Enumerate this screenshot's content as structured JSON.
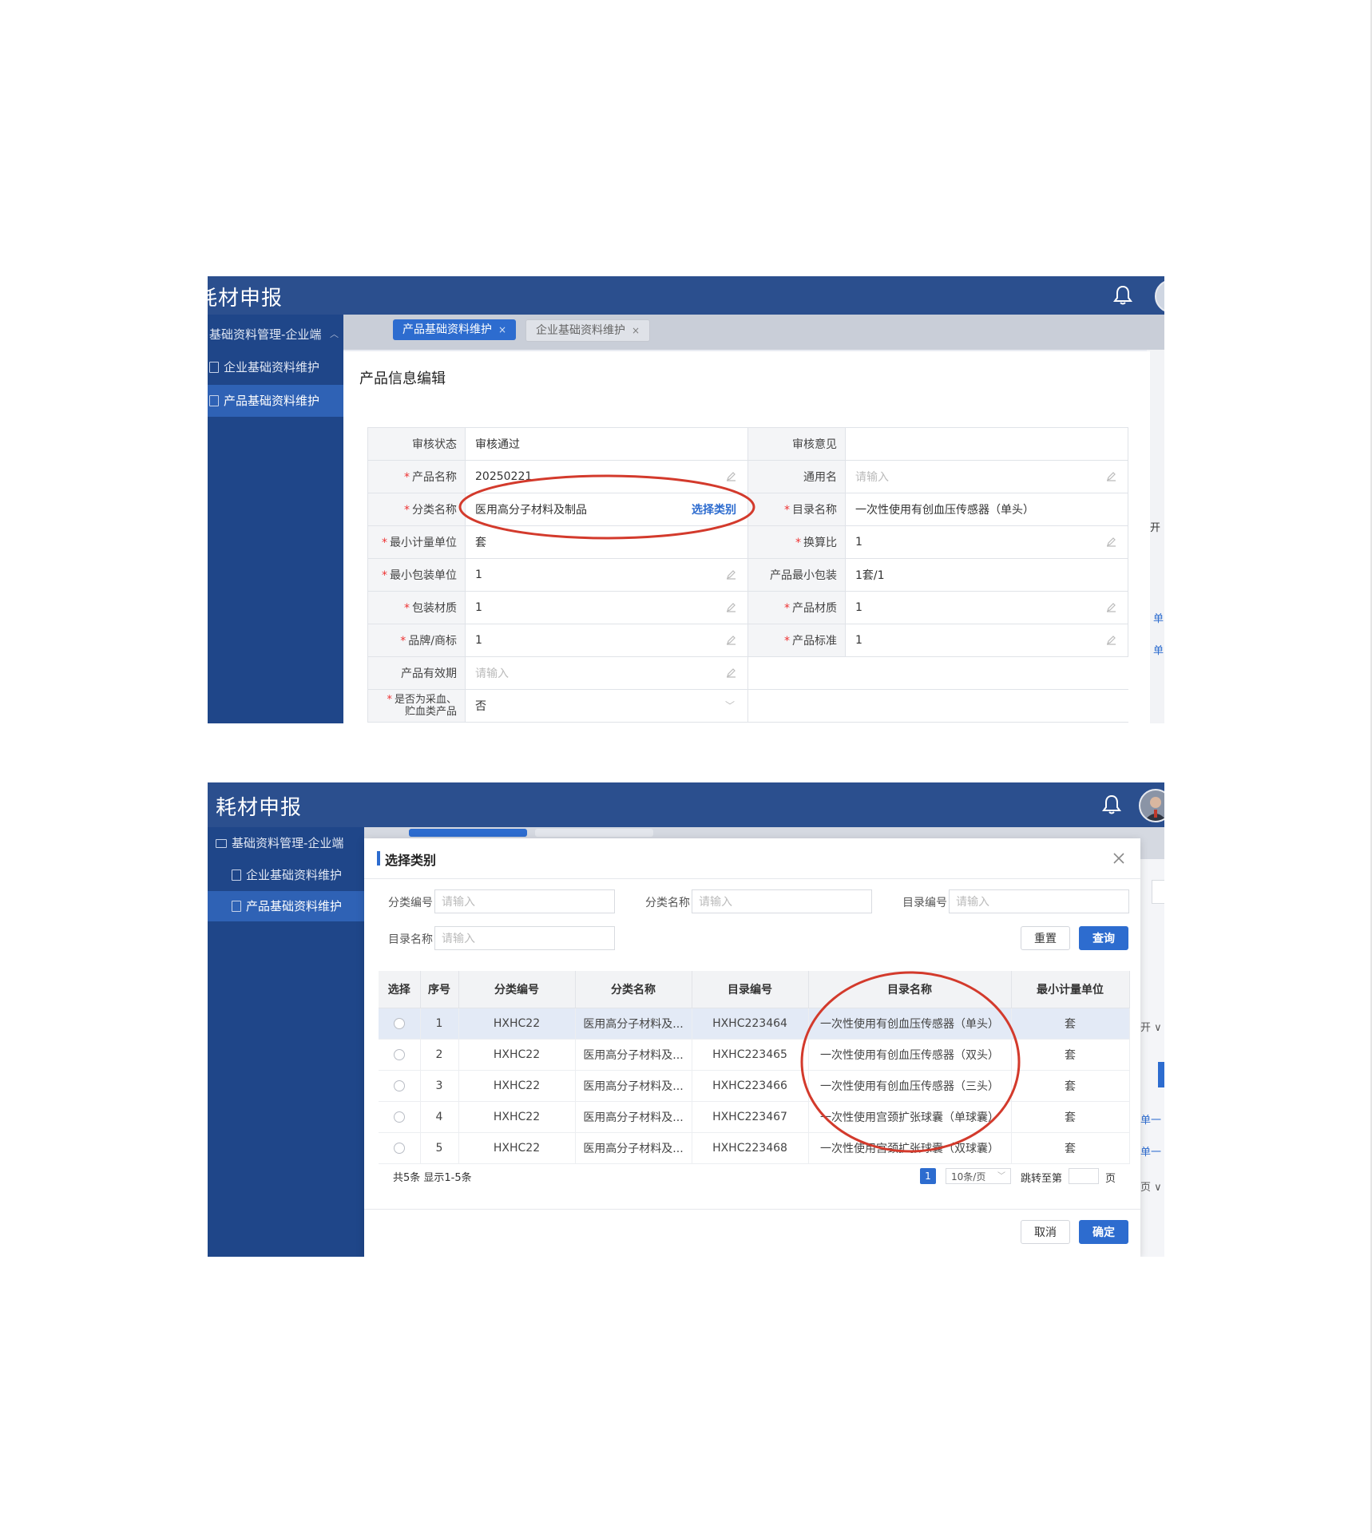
{
  "screen1": {
    "app_title": "耗材申报",
    "sidebar": {
      "group": "基础资料管理-企业端",
      "items": [
        {
          "label": "企业基础资料维护"
        },
        {
          "label": "产品基础资料维护"
        }
      ]
    },
    "tabs": [
      {
        "label": "产品基础资料维护",
        "close": "×"
      },
      {
        "label": "企业基础资料维护",
        "close": "×"
      }
    ],
    "panel_title": "产品信息编辑",
    "form": {
      "audit_status_label": "审核状态",
      "audit_status_value": "审核通过",
      "audit_opinion_label": "审核意见",
      "audit_opinion_value": "",
      "product_name_label": "产品名称",
      "product_name_value": "20250221",
      "common_name_label": "通用名",
      "common_name_placeholder": "请输入",
      "category_label": "分类名称",
      "category_value": "医用高分子材料及制品",
      "category_action": "选择类别",
      "catalog_name_label": "目录名称",
      "catalog_name_value": "一次性使用有创血压传感器（单头）",
      "min_unit_label": "最小计量单位",
      "min_unit_value": "套",
      "ratio_label": "换算比",
      "ratio_value": "1",
      "min_pack_unit_label": "最小包装单位",
      "min_pack_unit_value": "1",
      "product_min_pack_label": "产品最小包装",
      "product_min_pack_value": "1套/1",
      "pack_material_label": "包装材质",
      "pack_material_value": "1",
      "product_material_label": "产品材质",
      "product_material_value": "1",
      "brand_label": "品牌/商标",
      "brand_value": "1",
      "product_standard_label": "产品标准",
      "product_standard_value": "1",
      "validity_label": "产品有效期",
      "validity_placeholder": "请输入",
      "blood_label_1": "是否为采血、",
      "blood_label_2": "贮血类产品",
      "blood_value": "否"
    },
    "bg_fragments": [
      "开",
      "单",
      "单"
    ]
  },
  "screen2": {
    "app_title": "耗材申报",
    "sidebar": {
      "group": "基础资料管理-企业端",
      "items": [
        {
          "label": "企业基础资料维护"
        },
        {
          "label": "产品基础资料维护"
        }
      ]
    },
    "modal": {
      "title": "选择类别",
      "filters": {
        "category_code_label": "分类编号",
        "category_code_placeholder": "请输入",
        "category_name_label": "分类名称",
        "category_name_placeholder": "请输入",
        "catalog_code_label": "目录编号",
        "catalog_code_placeholder": "请输入",
        "catalog_name_label": "目录名称",
        "catalog_name_placeholder": "请输入"
      },
      "reset_label": "重置",
      "query_label": "查询",
      "columns": [
        "选择",
        "序号",
        "分类编号",
        "分类名称",
        "目录编号",
        "目录名称",
        "最小计量单位"
      ],
      "rows": [
        {
          "no": "1",
          "category_code": "HXHC22",
          "category_name": "医用高分子材料及...",
          "catalog_code": "HXHC223464",
          "catalog_name": "一次性使用有创血压传感器（单头）",
          "unit": "套"
        },
        {
          "no": "2",
          "category_code": "HXHC22",
          "category_name": "医用高分子材料及...",
          "catalog_code": "HXHC223465",
          "catalog_name": "一次性使用有创血压传感器（双头）",
          "unit": "套"
        },
        {
          "no": "3",
          "category_code": "HXHC22",
          "category_name": "医用高分子材料及...",
          "catalog_code": "HXHC223466",
          "catalog_name": "一次性使用有创血压传感器（三头）",
          "unit": "套"
        },
        {
          "no": "4",
          "category_code": "HXHC22",
          "category_name": "医用高分子材料及...",
          "catalog_code": "HXHC223467",
          "catalog_name": "一次性使用宫颈扩张球囊（单球囊）",
          "unit": "套"
        },
        {
          "no": "5",
          "category_code": "HXHC22",
          "category_name": "医用高分子材料及...",
          "catalog_code": "HXHC223468",
          "catalog_name": "一次性使用宫颈扩张球囊（双球囊）",
          "unit": "套"
        }
      ],
      "footer": {
        "summary": "共5条 显示1-5条",
        "current_page": "1",
        "page_size": "10条/页",
        "jump_label": "跳转至第",
        "page_suffix": "页"
      },
      "cancel_label": "取消",
      "confirm_label": "确定"
    },
    "bg_fragments": [
      "开 ∨",
      "单一",
      "单一",
      "页 ∨"
    ]
  },
  "colors": {
    "header": "#2b4f8e",
    "sidebar": "#1f4689",
    "accent": "#2d6ccf",
    "annotation_circle": "#d33a2c"
  },
  "icons": {
    "bell": "bell-icon",
    "close": "close-icon",
    "settings": "gear-icon",
    "edit": "pencil-icon",
    "document": "document-icon",
    "folder": "folder-icon"
  }
}
